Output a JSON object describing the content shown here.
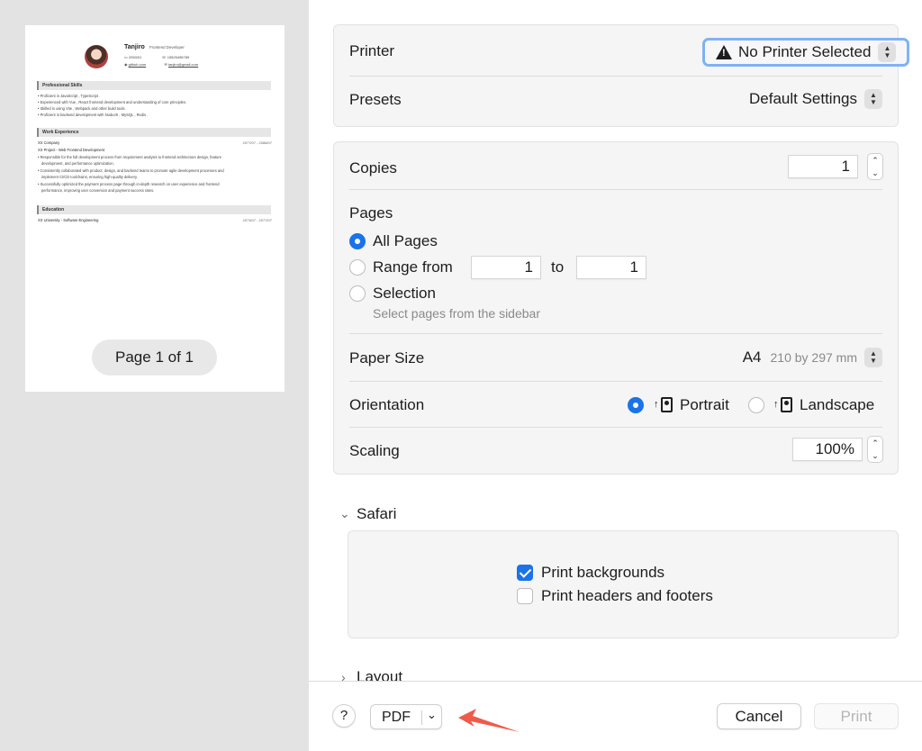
{
  "preview": {
    "resume": {
      "name": "Tanjiro",
      "role": "Frontend Developer",
      "date": "2050/01",
      "phone": "15525456789",
      "github": "github.com",
      "email": "tanjiro@gmail.com",
      "sections": {
        "skills": "Professional Skills",
        "experience": "Work Experience",
        "education": "Education"
      },
      "skills": [
        "Proficient in  JavaScript ,  TypeScript .",
        "Experienced with  Vue ,  React  frontend development and understanding of core principles.",
        "Skilled in using  Vite ,  Webpack  and other build tools.",
        "Proficient in backend development with  NodeJS ,  MySQL ,  Redis ."
      ],
      "company": "XX Company",
      "company_dates": "2077/07 - 2088/07",
      "project": "XX Project - Web Frontend Development",
      "experience": [
        "Responsible for the full development process from requirement analysis to frontend architecture design, feature",
        "development, and performance optimization.",
        "Consistently collaborated with product, design, and backend teams to promote agile development processes and",
        "implement CI/CD toolchains, ensuring high-quality delivery.",
        "Successfully optimized the payment process page through in-depth research on user experience and frontend",
        "performance, improving user conversion and payment success rates."
      ],
      "university": "XX University - Software Engineering",
      "university_dates": "2073/07 - 2077/07"
    },
    "page_indicator": "Page 1 of 1"
  },
  "printer": {
    "label": "Printer",
    "value": "No Printer Selected"
  },
  "presets": {
    "label": "Presets",
    "value": "Default Settings"
  },
  "copies": {
    "label": "Copies",
    "value": "1"
  },
  "pages": {
    "label": "Pages",
    "all": "All Pages",
    "range_from": "Range from",
    "from_value": "1",
    "to": "to",
    "to_value": "1",
    "selection": "Selection",
    "selection_hint": "Select pages from the sidebar",
    "selected": "All Pages"
  },
  "paper_size": {
    "label": "Paper Size",
    "value": "A4",
    "dimensions": "210 by 297 mm"
  },
  "orientation": {
    "label": "Orientation",
    "portrait": "Portrait",
    "landscape": "Landscape",
    "selected": "Portrait"
  },
  "scaling": {
    "label": "Scaling",
    "value": "100%"
  },
  "safari": {
    "label": "Safari",
    "print_backgrounds": "Print backgrounds",
    "print_backgrounds_checked": true,
    "headers_footers": "Print headers and footers",
    "headers_footers_checked": false
  },
  "layout": {
    "label": "Layout"
  },
  "footer": {
    "help": "?",
    "pdf": "PDF",
    "cancel": "Cancel",
    "print": "Print"
  },
  "colors": {
    "accent": "#1a73e8",
    "focus_ring": "#7fb2f4",
    "annotation_arrow": "#f05a4a"
  }
}
